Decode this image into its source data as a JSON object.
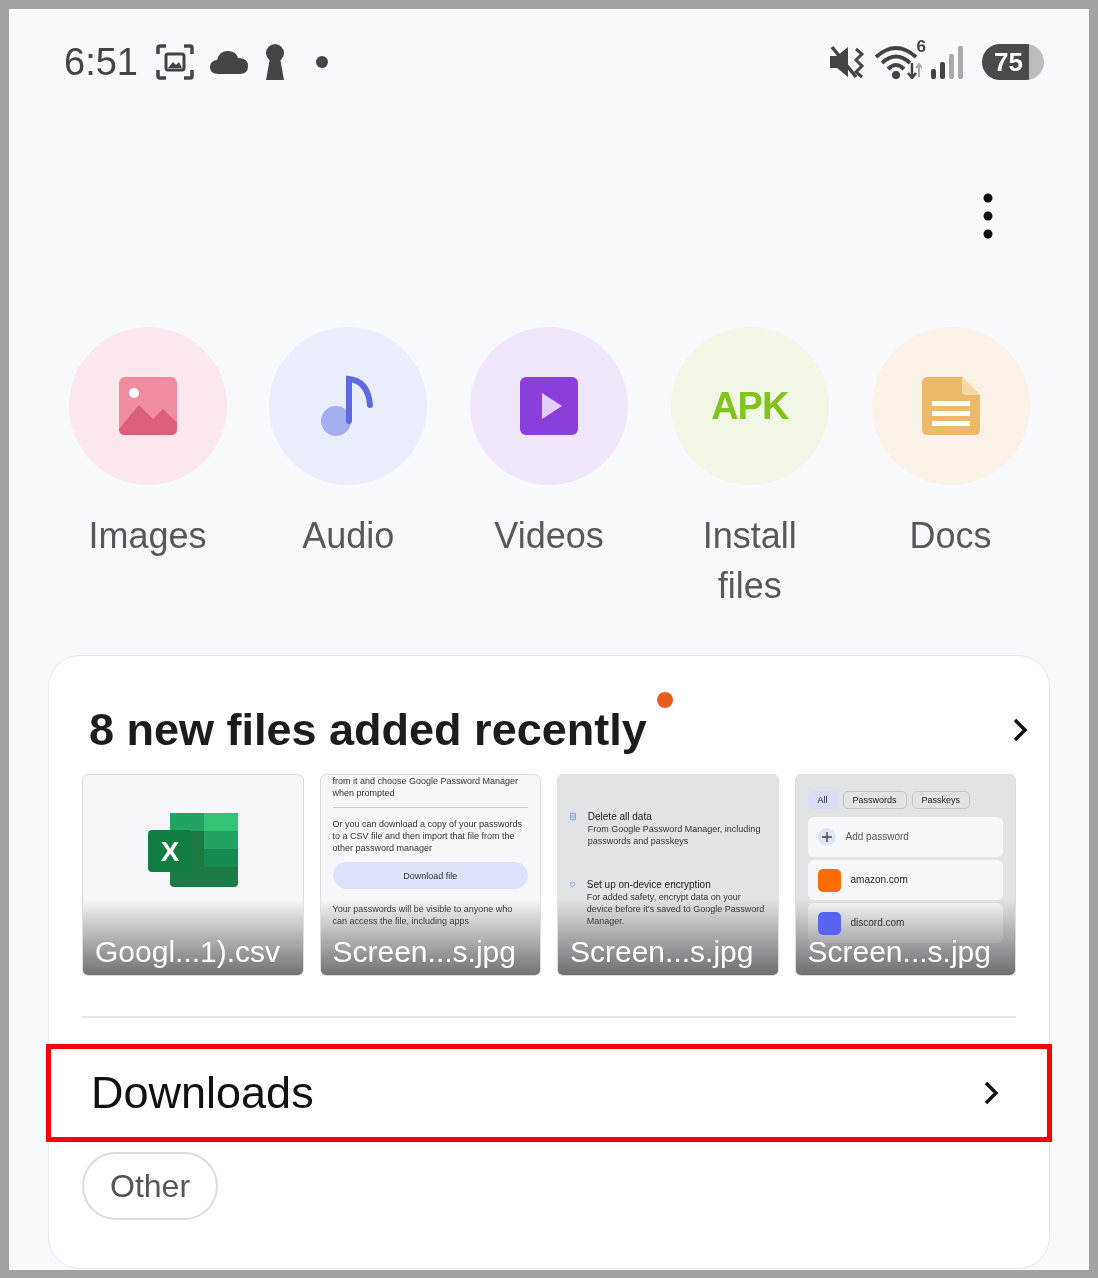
{
  "status_bar": {
    "time": "6:51",
    "wifi_badge": "6",
    "battery": "75"
  },
  "categories": [
    {
      "kind": "images",
      "label": "Images"
    },
    {
      "kind": "audio",
      "label": "Audio"
    },
    {
      "kind": "videos",
      "label": "Videos"
    },
    {
      "kind": "apk",
      "label": "Install files",
      "icon_text": "APK"
    },
    {
      "kind": "docs",
      "label": "Docs"
    }
  ],
  "recent": {
    "title": "8 new files added recently",
    "new_dot": true,
    "files": [
      {
        "kind": "spreadsheet",
        "name": "Googl...1).csv",
        "icon_text": "X",
        "shaded": false
      },
      {
        "kind": "screenshot",
        "name": "Screen...s.jpg",
        "shaded": false,
        "blocks": [
          {
            "kind": "text",
            "text": "from it and choose Google Password Manager when prompted"
          },
          {
            "kind": "divider"
          },
          {
            "kind": "text",
            "text": "Or you can download a copy of your passwords to a CSV file and then import that file from the other password manager"
          },
          {
            "kind": "button",
            "text": "Download file"
          },
          {
            "kind": "text",
            "text": "Your passwords will be visible to anyone who can access the file, including apps"
          }
        ]
      },
      {
        "kind": "screenshot",
        "name": "Screen...s.jpg",
        "shaded": true,
        "blocks": [
          {
            "kind": "trash-row",
            "title": "Delete all data",
            "text": "From Google Password Manager, including passwords and passkeys"
          },
          {
            "kind": "shield-row",
            "title": "Set up on-device encryption",
            "text": "For added safety, encrypt data on your device before it’s saved to Google Password Manager."
          }
        ]
      },
      {
        "kind": "screenshot",
        "name": "Screen...s.jpg",
        "shaded": true,
        "blocks": [
          {
            "kind": "chips",
            "chips": [
              {
                "label": "All",
                "selected": true
              },
              {
                "label": "Passwords",
                "selected": false
              },
              {
                "label": "Passkeys",
                "selected": false
              }
            ]
          },
          {
            "kind": "add-row",
            "text": "Add password"
          },
          {
            "kind": "site-row",
            "text": "amazon.com",
            "color": "#ff6d00"
          },
          {
            "kind": "site-row",
            "text": "discord.com",
            "color": "#5865f2"
          }
        ]
      }
    ]
  },
  "downloads": {
    "label": "Downloads",
    "highlighted": true
  },
  "chips": [
    {
      "label": "Other"
    }
  ]
}
